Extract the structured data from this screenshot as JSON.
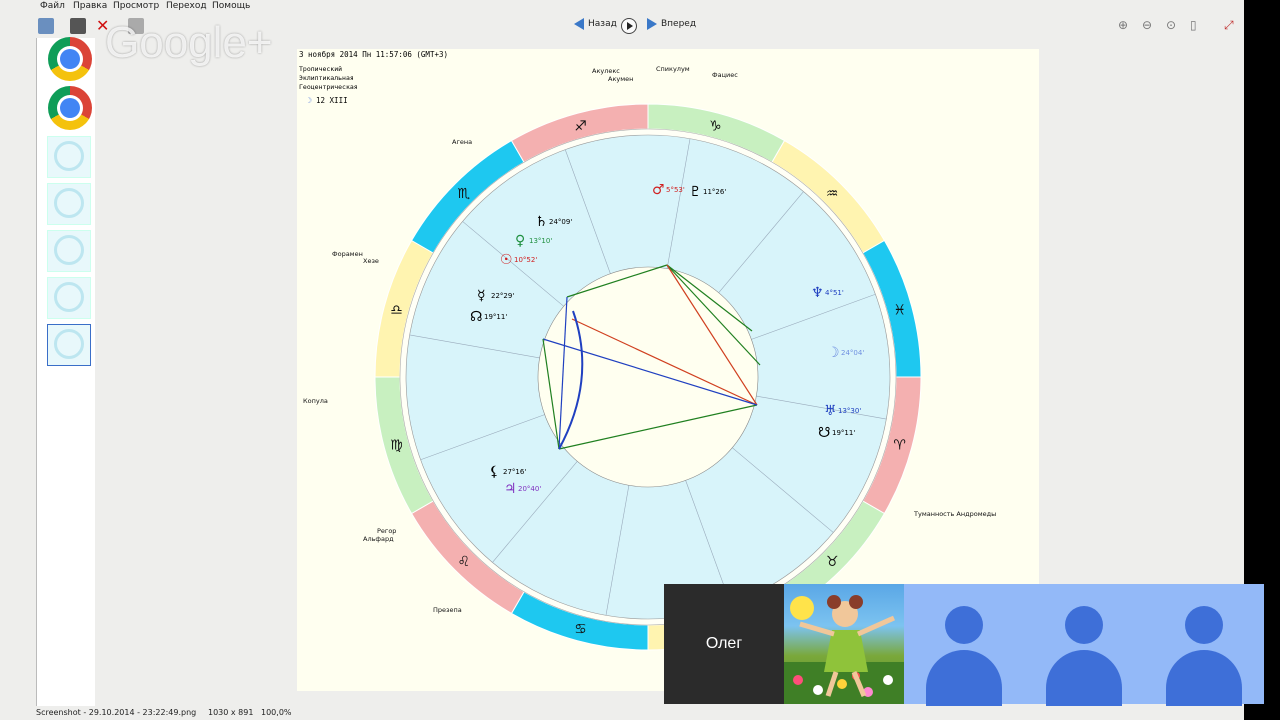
{
  "menu": [
    "Файл",
    "Правка",
    "Просмотр",
    "Переход",
    "Помощь"
  ],
  "nav": {
    "back": "Назад",
    "forward": "Вперед"
  },
  "overlay_brand": "Google+",
  "chart_header": {
    "date_line": "3 ноября 2014  Пн  11:57:06 (GMT+3)",
    "lines": [
      "Тропический",
      "Эклиптикальная",
      "Геоцентрическая"
    ],
    "moon_day": "12 XIII"
  },
  "stars": [
    {
      "label": "Акулекс",
      "pos": "top-center"
    },
    {
      "label": "Спикулум"
    },
    {
      "label": "Акумен"
    },
    {
      "label": "Фациес"
    },
    {
      "label": "Агена"
    },
    {
      "label": "Форамен"
    },
    {
      "label": "Хезе"
    },
    {
      "label": "Копула"
    },
    {
      "label": "Регор"
    },
    {
      "label": "Альфард"
    },
    {
      "label": "Презепа"
    },
    {
      "label": "Туманность Андромеды"
    }
  ],
  "planets": [
    {
      "glyph": "♂",
      "deg": "5°53'",
      "color": "#d02020"
    },
    {
      "glyph": "♇",
      "deg": "11°26'",
      "color": "#000000"
    },
    {
      "glyph": "♄",
      "deg": "24°09'",
      "color": "#000000"
    },
    {
      "glyph": "♀",
      "deg": "13°10'",
      "color": "#209040"
    },
    {
      "glyph": "☉",
      "deg": "10°52'",
      "color": "#d02020"
    },
    {
      "glyph": "☿",
      "deg": "22°29'",
      "color": "#000000"
    },
    {
      "glyph": "☊",
      "deg": "19°11'",
      "color": "#000000"
    },
    {
      "glyph": "♆",
      "deg": "4°51'",
      "color": "#2040c0"
    },
    {
      "glyph": "☽",
      "deg": "24°04'",
      "color": "#7090e0"
    },
    {
      "glyph": "♅",
      "deg": "13°30'",
      "color": "#2040c0"
    },
    {
      "glyph": "☋",
      "deg": "19°11'",
      "color": "#000000"
    },
    {
      "glyph": "⚸",
      "deg": "27°16'",
      "color": "#000000"
    },
    {
      "glyph": "♃",
      "deg": "20°40'",
      "color": "#8030c0"
    }
  ],
  "signs": [
    "♑",
    "♒",
    "♓",
    "♈",
    "♉",
    "♊",
    "♋",
    "♌",
    "♍",
    "♎",
    "♏",
    "♐"
  ],
  "colors": {
    "fire": "#f4b0b0",
    "earth": "#c8f0c0",
    "air": "#fff4b0",
    "water": "#1ec8f0",
    "inner_disc": "#d8f4fa"
  },
  "status": {
    "filename": "Screenshot - 29.10.2014 - 23:22:49.png",
    "dimensions": "1030 x 891",
    "zoom": "100,0%"
  },
  "hangout": {
    "participant_name": "Олег"
  }
}
